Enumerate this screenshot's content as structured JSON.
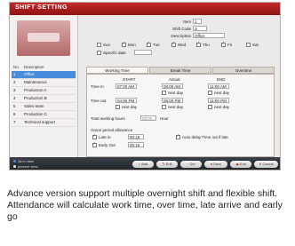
{
  "window": {
    "title": "SHIFT SETTING"
  },
  "left_panel": {
    "columns": [
      "No.",
      "Description"
    ],
    "rows": [
      {
        "no": "1",
        "desc": "Office",
        "selected": true
      },
      {
        "no": "2",
        "desc": "Maintenance"
      },
      {
        "no": "3",
        "desc": "Production A"
      },
      {
        "no": "4",
        "desc": "Production B"
      },
      {
        "no": "5",
        "desc": "Sales team"
      },
      {
        "no": "6",
        "desc": "Production C"
      },
      {
        "no": "7",
        "desc": "Technical support"
      }
    ]
  },
  "form": {
    "item_label": "Item",
    "item_value": "1",
    "shift_code_label": "Shift Code",
    "shift_code_value": "S",
    "description_label": "Description",
    "description_value": "Office",
    "days": [
      {
        "label": "Sun",
        "checked": false
      },
      {
        "label": "Mon",
        "checked": true
      },
      {
        "label": "Tue",
        "checked": true
      },
      {
        "label": "Wed",
        "checked": true
      },
      {
        "label": "Thu",
        "checked": true
      },
      {
        "label": "Fri",
        "checked": true
      },
      {
        "label": "Sat",
        "checked": false
      }
    ],
    "specific_date_label": "Specific date"
  },
  "tabs": [
    "Working Time",
    "Break Time",
    "Overtime"
  ],
  "working_time": {
    "col_start": "START",
    "col_actual": "Actual",
    "col_end": "END",
    "time_in_label": "Time in",
    "time_in_start": "07:00 AM",
    "time_in_actual": "08:00 AM",
    "time_in_end": "11:00 AM",
    "next_day": "next day",
    "time_out_label": "Time out",
    "time_out_start": "04:00 PM",
    "time_out_actual": "05:00 PM",
    "time_out_end": "11:00 PM",
    "total_hours_label": "Total working hours",
    "total_hours_value": "08:00",
    "hour_unit": "Hour",
    "grace_label": "Grace period allowance",
    "late_in_label": "Late in",
    "late_in_value": "00:15",
    "early_out_label": "Early Out",
    "early_out_value": "00:15",
    "auto_delay_label": "Auto delay Time out if late"
  },
  "legend": [
    "All in view",
    "present view"
  ],
  "buttons": [
    "Add",
    "Edit",
    "Del",
    "Save",
    "Exit",
    "Cancel"
  ],
  "caption": "Advance version support multiple overnight shift and flexible shift. Attendance will calculate work time, over time, late arrive and early go",
  "colors": {
    "title_red": "#b51f1f",
    "selected_row": "#4a8cdc"
  }
}
